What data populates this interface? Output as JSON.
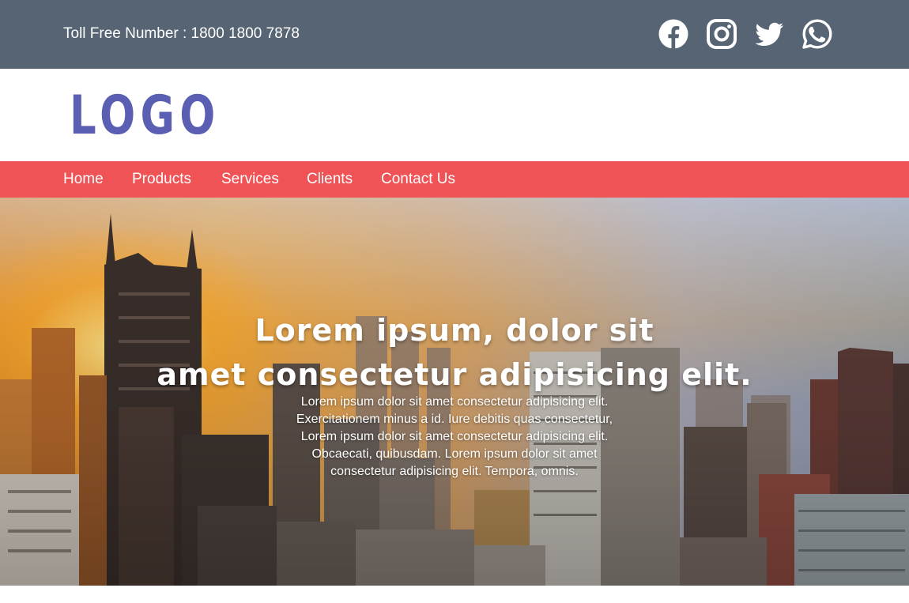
{
  "topbar": {
    "toll_free": "Toll Free Number : 1800 1800 7878",
    "social": [
      {
        "icon": "facebook-icon"
      },
      {
        "icon": "instagram-icon"
      },
      {
        "icon": "twitter-icon"
      },
      {
        "icon": "whatsapp-icon"
      }
    ]
  },
  "header": {
    "logo_text": "LOGO"
  },
  "nav": {
    "items": [
      {
        "label": "Home"
      },
      {
        "label": "Products"
      },
      {
        "label": "Services"
      },
      {
        "label": "Clients"
      },
      {
        "label": "Contact Us"
      }
    ]
  },
  "hero": {
    "title_line1": "Lorem ipsum, dolor sit",
    "title_line2": "amet consectetur adipisicing elit.",
    "text_lines": [
      "Lorem ipsum dolor sit amet consectetur adipisicing elit.",
      "Exercitationem minus a id. Iure debitis quas consectetur,",
      "Lorem ipsum dolor sit amet consectetur adipisicing elit.",
      "Obcaecati, quibusdam. Lorem ipsum dolor sit amet",
      "consectetur adipisicing elit. Tempora, omnis."
    ]
  },
  "colors": {
    "topbar": "#566473",
    "nav": "#ef5356",
    "logo": "#5a5fb3",
    "text_on_dark": "#ffffff"
  }
}
